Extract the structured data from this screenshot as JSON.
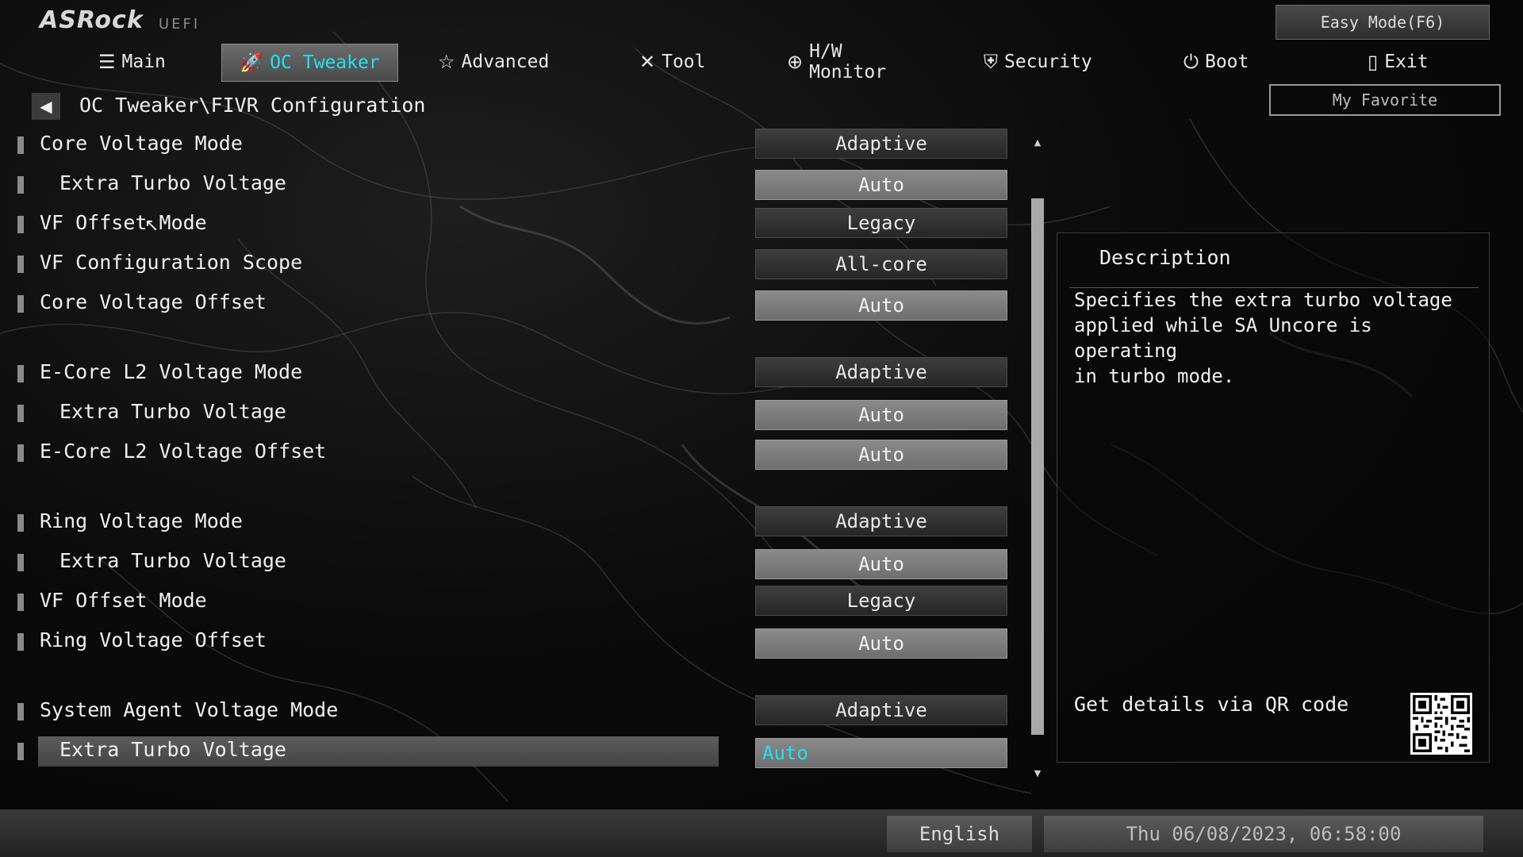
{
  "brand": {
    "name": "ASRock",
    "sub": "UEFI"
  },
  "header": {
    "easy_mode": "Easy Mode(F6)",
    "my_favorite": "My Favorite"
  },
  "nav": [
    {
      "label": "Main",
      "icon": "list-icon"
    },
    {
      "label": "OC Tweaker",
      "icon": "rocket-icon",
      "active": true
    },
    {
      "label": "Advanced",
      "icon": "star-icon"
    },
    {
      "label": "Tool",
      "icon": "wrench-icon"
    },
    {
      "label": "H/W Monitor",
      "icon": "monitor-icon"
    },
    {
      "label": "Security",
      "icon": "shield-icon"
    },
    {
      "label": "Boot",
      "icon": "power-icon"
    },
    {
      "label": "Exit",
      "icon": "door-icon"
    }
  ],
  "breadcrumb": "OC Tweaker\\FIVR Configuration",
  "settings": [
    {
      "label": "Core Voltage Mode",
      "value": "Adaptive"
    },
    {
      "label": "Extra Turbo Voltage",
      "value": "Auto"
    },
    {
      "label": "VF Offset Mode",
      "value": "Legacy"
    },
    {
      "label": "VF Configuration Scope",
      "value": "All-core"
    },
    {
      "label": "Core Voltage Offset",
      "value": "Auto"
    },
    {
      "label": "E-Core L2 Voltage Mode",
      "value": "Adaptive"
    },
    {
      "label": "Extra Turbo Voltage",
      "value": "Auto"
    },
    {
      "label": "E-Core L2 Voltage Offset",
      "value": "Auto"
    },
    {
      "label": "Ring Voltage Mode",
      "value": "Adaptive"
    },
    {
      "label": "Extra Turbo Voltage",
      "value": "Auto"
    },
    {
      "label": "VF Offset Mode",
      "value": "Legacy"
    },
    {
      "label": "Ring Voltage Offset",
      "value": "Auto"
    },
    {
      "label": "System Agent Voltage Mode",
      "value": "Adaptive"
    },
    {
      "label": "Extra Turbo Voltage",
      "value": "Auto"
    }
  ],
  "description": {
    "title": "Description",
    "text": "Specifies the extra turbo voltage\napplied while SA Uncore is operating\nin turbo mode.",
    "qr_label": "Get details via QR code"
  },
  "footer": {
    "language": "English",
    "datetime": "Thu 06/08/2023, 06:58:00"
  },
  "colors": {
    "accent": "#23e0f0"
  }
}
